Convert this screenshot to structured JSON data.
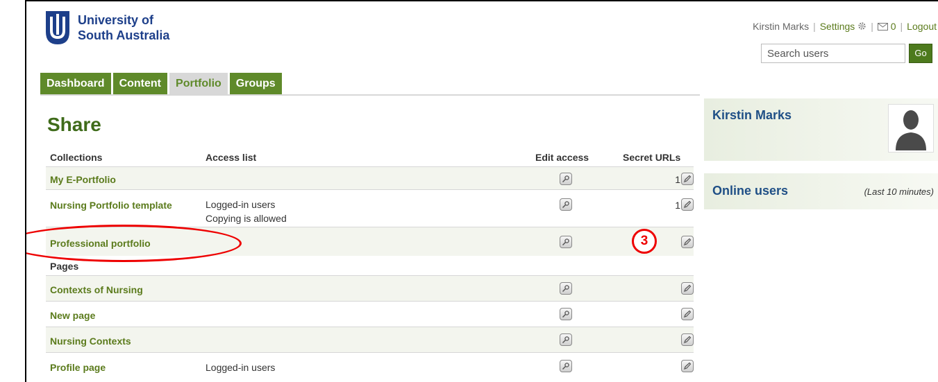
{
  "header": {
    "university_line1": "University of",
    "university_line2": "South Australia",
    "user_name": "Kirstin Marks",
    "settings_label": "Settings",
    "inbox_count": "0",
    "logout_label": "Logout",
    "search_placeholder": "Search users",
    "go_label": "Go"
  },
  "tabs": [
    {
      "label": "Dashboard",
      "active": false
    },
    {
      "label": "Content",
      "active": false
    },
    {
      "label": "Portfolio",
      "active": true
    },
    {
      "label": "Groups",
      "active": false
    }
  ],
  "main": {
    "title": "Share",
    "columns": {
      "collections": "Collections",
      "access_list": "Access list",
      "edit_access": "Edit access",
      "secret_urls": "Secret URLs"
    },
    "collections": [
      {
        "name": "My E-Portfolio",
        "access": [],
        "secret_count": "1"
      },
      {
        "name": "Nursing Portfolio template",
        "access": [
          "Logged-in users",
          "Copying is allowed"
        ],
        "secret_count": "1"
      },
      {
        "name": "Professional portfolio",
        "access": [],
        "secret_count": ""
      }
    ],
    "pages_label": "Pages",
    "pages": [
      {
        "name": "Contexts of Nursing",
        "access": ""
      },
      {
        "name": "New page",
        "access": ""
      },
      {
        "name": "Nursing Contexts",
        "access": ""
      },
      {
        "name": "Profile page",
        "access": "Logged-in users"
      }
    ],
    "annotation_number": "3"
  },
  "sidebar": {
    "profile_name": "Kirstin Marks",
    "online_title": "Online users",
    "online_note": "(Last 10 minutes)"
  },
  "colors": {
    "brand_green": "#5f8a2a",
    "link_green": "#5b7b1c",
    "title_green": "#3f6b1a",
    "uni_blue": "#1d3f8a",
    "sidebar_blue": "#1f4f86",
    "annotation_red": "#e00000"
  }
}
